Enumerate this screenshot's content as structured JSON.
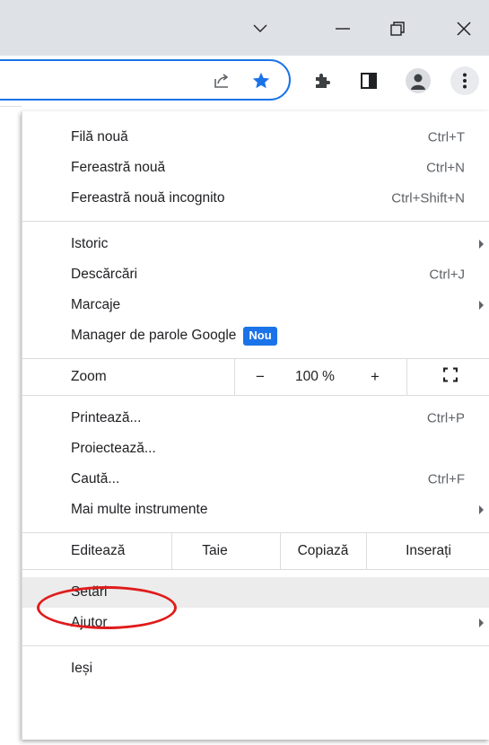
{
  "window_controls": {
    "icons": [
      "chevron-down-icon",
      "minimize-icon",
      "restore-icon",
      "close-icon"
    ]
  },
  "toolbar": {
    "icons": [
      "share-icon",
      "bookmark-star-icon",
      "extensions-puzzle-icon",
      "side-panel-icon",
      "profile-avatar-icon",
      "kebab-menu-icon"
    ],
    "accent": "#1a73e8"
  },
  "menu": {
    "new_tab": {
      "label": "Filă nouă",
      "shortcut": "Ctrl+T"
    },
    "new_window": {
      "label": "Fereastră nouă",
      "shortcut": "Ctrl+N"
    },
    "incognito": {
      "label": "Fereastră nouă incognito",
      "shortcut": "Ctrl+Shift+N"
    },
    "history": {
      "label": "Istoric"
    },
    "downloads": {
      "label": "Descărcări",
      "shortcut": "Ctrl+J"
    },
    "bookmarks": {
      "label": "Marcaje"
    },
    "password_manager": {
      "label": "Manager de parole Google",
      "badge": "Nou"
    },
    "zoom": {
      "label": "Zoom",
      "minus": "−",
      "value": "100 %",
      "plus": "+",
      "fullscreen_icon": "fullscreen-icon"
    },
    "print": {
      "label": "Printează...",
      "shortcut": "Ctrl+P"
    },
    "cast": {
      "label": "Proiectează..."
    },
    "find": {
      "label": "Caută...",
      "shortcut": "Ctrl+F"
    },
    "more_tools": {
      "label": "Mai multe instrumente"
    },
    "edit": {
      "label": "Editează",
      "cut": "Taie",
      "copy": "Copiază",
      "paste": "Inserați"
    },
    "settings": {
      "label": "Setări",
      "highlight_color": "#e01b1b"
    },
    "help": {
      "label": "Ajutor"
    },
    "exit": {
      "label": "Ieși"
    }
  }
}
